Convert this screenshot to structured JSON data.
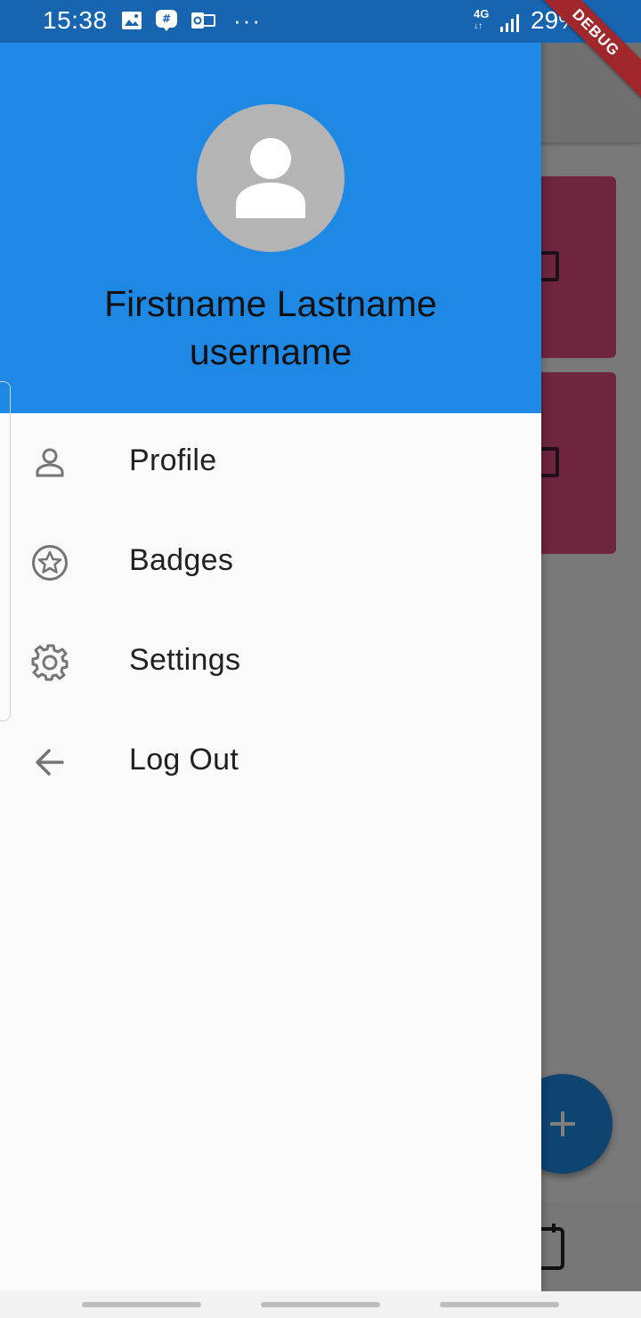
{
  "status_bar": {
    "time": "15:38",
    "network": "4G",
    "battery": "29%",
    "icons": [
      "gallery-icon",
      "chat-icon",
      "outlook-icon",
      "more-icon",
      "signal-icon"
    ]
  },
  "debug_banner": "DEBUG",
  "drawer": {
    "header": {
      "fullname": "Firstname Lastname",
      "username": "username",
      "background_color": "#1e88e5"
    },
    "menu": [
      {
        "label": "Profile",
        "icon": "person-icon"
      },
      {
        "label": "Badges",
        "icon": "star-badge-icon"
      },
      {
        "label": "Settings",
        "icon": "gear-icon"
      },
      {
        "label": "Log Out",
        "icon": "arrow-back-icon"
      }
    ]
  },
  "background_app": {
    "card_color": "#dc4a7a",
    "fab_icon": "plus-icon",
    "bottom_icon": "calendar-icon"
  }
}
